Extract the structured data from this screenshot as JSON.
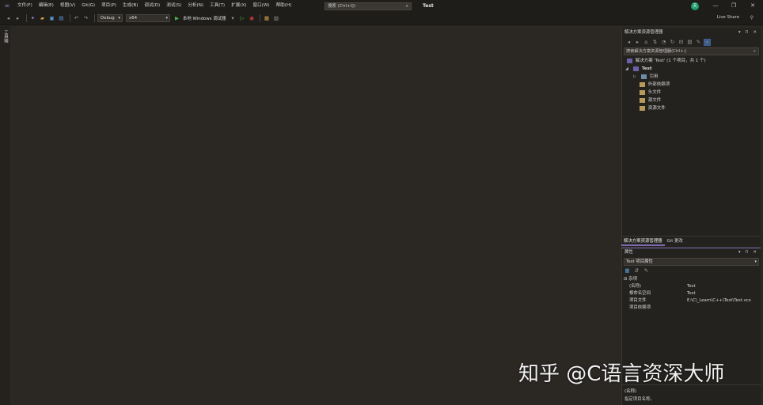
{
  "title": "Test",
  "menu": [
    "文件(F)",
    "编辑(E)",
    "视图(V)",
    "Git(G)",
    "项目(P)",
    "生成(B)",
    "调试(D)",
    "测试(S)",
    "分析(N)",
    "工具(T)",
    "扩展(X)",
    "窗口(W)",
    "帮助(H)"
  ],
  "search": {
    "placeholder": "搜索 (Ctrl+Q)"
  },
  "user_initial": "天",
  "window_buttons": {
    "minimize": "—",
    "restore": "❐",
    "close": "✕"
  },
  "toolbar": {
    "config": "Debug",
    "platform": "x64",
    "run_label": "本地 Windows 调试器",
    "live_share": "Live Share"
  },
  "toolbox_label": "工具箱",
  "solution_explorer": {
    "header": "解决方案资源管理器",
    "header_buttons": "▾ ⊓ ✕",
    "search_placeholder": "搜索解决方案资源管理器(Ctrl+;)",
    "solution_row": "解决方案 'Test' (1 个项目，共 1 个)",
    "project": "Test",
    "items": [
      "引用",
      "外部依赖项",
      "头文件",
      "源文件",
      "资源文件"
    ]
  },
  "bottom_tabs": [
    "解决方案资源管理器",
    "Git 更改"
  ],
  "properties": {
    "header": "属性",
    "header_buttons": "▾ ⊓ ✕",
    "selector": "Test 项目属性",
    "category": "杂项",
    "rows": [
      {
        "name": "(名称)",
        "value": "Test"
      },
      {
        "name": "根命名空间",
        "value": "Test"
      },
      {
        "name": "项目文件",
        "value": "E:\\C\\_Learn\\C++\\Test\\Test.vcx"
      },
      {
        "name": "项目依赖项",
        "value": ""
      }
    ],
    "desc_title": "(名称)",
    "desc_text": "指定项目名称。"
  },
  "watermark": "知乎 @C语言资深大师",
  "colors": {
    "accent": "#7d6ab0",
    "background": "#2b2824",
    "chrome": "#1f1d1a",
    "avatar": "#1d9a6c"
  }
}
